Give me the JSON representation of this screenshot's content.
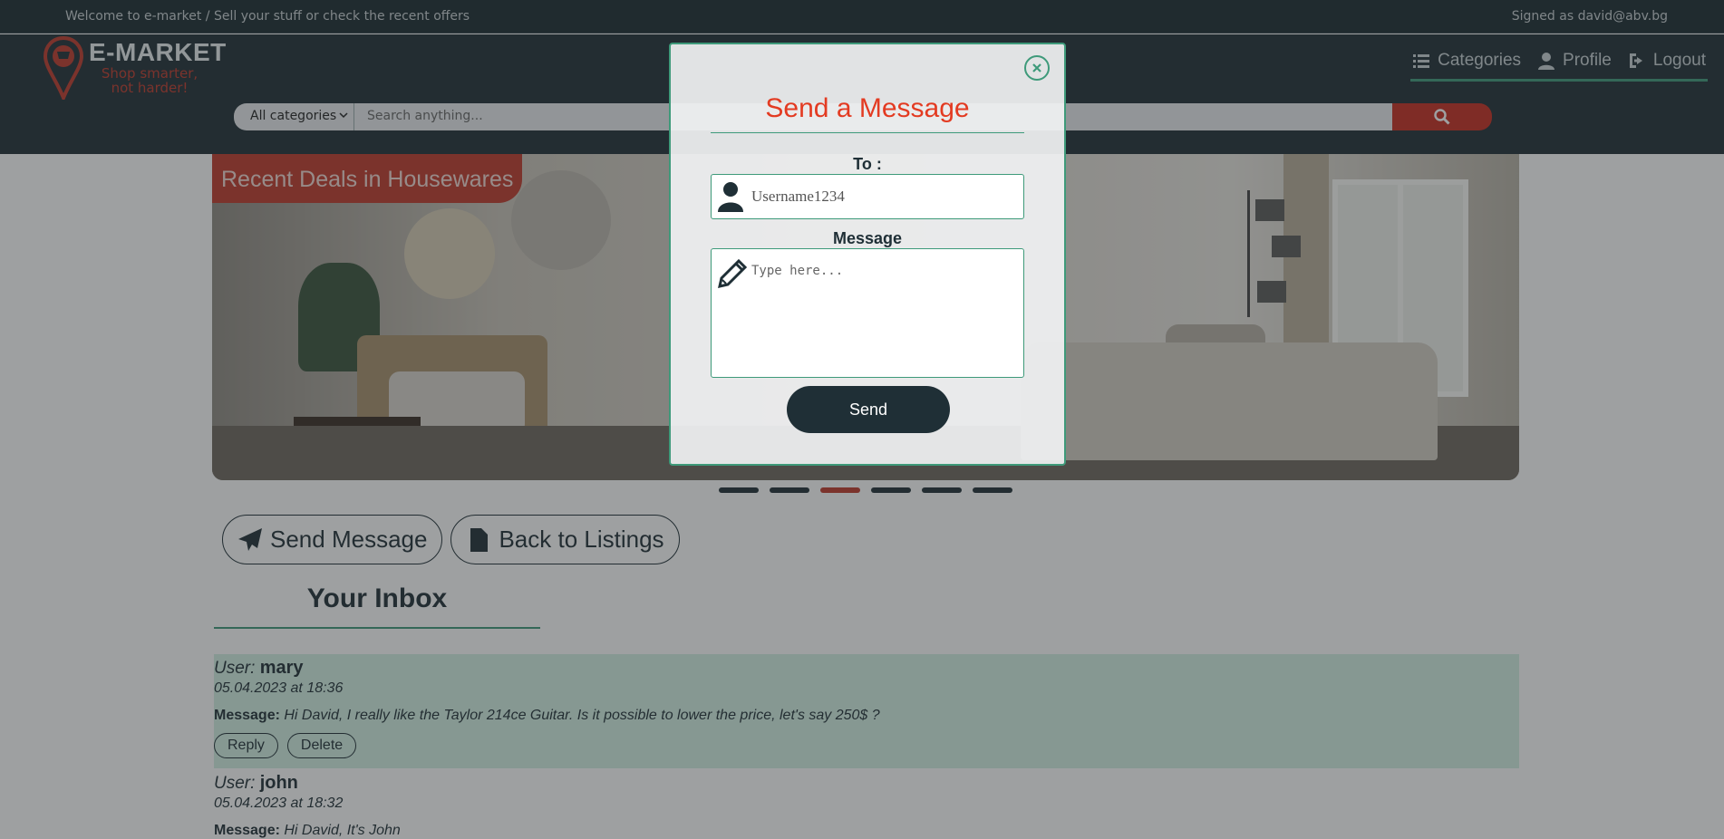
{
  "topbar": {
    "welcome": "Welcome to e-market / Sell your stuff or check the recent offers",
    "signed_in": "Signed as david@abv.bg"
  },
  "header": {
    "logo_name": "E-MARKET",
    "logo_tagline": "Shop smarter, not harder!",
    "nav": [
      {
        "label": "Categories",
        "icon": "list-icon"
      },
      {
        "label": "Profile",
        "icon": "user-icon"
      },
      {
        "label": "Logout",
        "icon": "logout-icon"
      }
    ],
    "search": {
      "category_selected": "All categories",
      "placeholder": "Search anything..."
    }
  },
  "banner": {
    "title": "Recent Deals in Housewares",
    "slide_count": 6,
    "active_slide": 3
  },
  "actions": {
    "send_message": "Send Message",
    "back_to_listings": "Back to Listings"
  },
  "inbox": {
    "title": "Your Inbox",
    "user_prefix": "User:",
    "message_prefix": "Message:",
    "reply_label": "Reply",
    "delete_label": "Delete",
    "messages": [
      {
        "user": "mary",
        "date": "05.04.2023 at 18:36",
        "text": "Hi David, I really like the Taylor 214ce Guitar. Is it possible to lower the price, let's say 250$ ?"
      },
      {
        "user": "john",
        "date": "05.04.2023 at 18:32",
        "text": "Hi David, It's John"
      }
    ]
  },
  "modal": {
    "title": "Send a Message",
    "to_label": "To :",
    "to_placeholder": "Username1234",
    "message_label": "Message",
    "message_placeholder": "Type here...",
    "send_label": "Send"
  },
  "colors": {
    "header_bg": "#1f2f36",
    "accent_red": "#c0392b",
    "accent_green": "#3e9a7a",
    "highlight_row": "#d4f1e4"
  }
}
